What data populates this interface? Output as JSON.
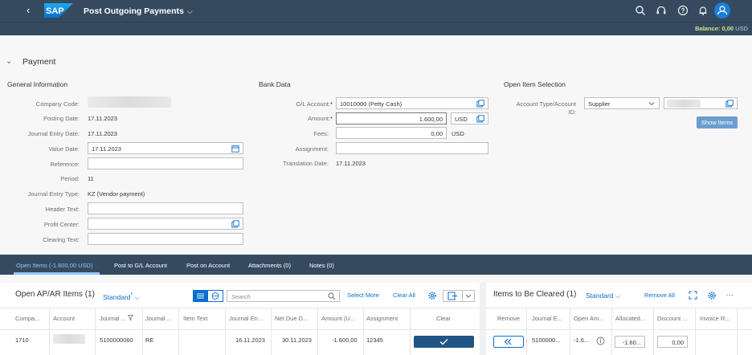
{
  "shell": {
    "app_title": "Post Outgoing Payments",
    "logo_text": "SAP",
    "icons": [
      "search-icon",
      "headset-icon",
      "help-icon",
      "bell-icon",
      "user-icon"
    ]
  },
  "balance": {
    "label": "Balance: 0,00",
    "unit": "USD"
  },
  "section": {
    "title": "Payment"
  },
  "general": {
    "title": "General Information",
    "company_code_label": "Company Code:",
    "posting_date_label": "Posting Date:",
    "posting_date": "17.11.2023",
    "journal_entry_date_label": "Journal Entry Date:",
    "journal_entry_date": "17.11.2023",
    "value_date_label": "Value Date:",
    "value_date": "17.11.2023",
    "reference_label": "Reference:",
    "period_label": "Period:",
    "period": "11",
    "journal_entry_type_label": "Journal Entry Type:",
    "journal_entry_type": "KZ (Vendor payment)",
    "header_text_label": "Header Text:",
    "profit_center_label": "Profit Center:",
    "clearing_text_label": "Clearing Text:"
  },
  "bank": {
    "title": "Bank Data",
    "gl_account_label": "G/L Account:",
    "gl_account": "10010000 (Petty Cash)",
    "amount_label": "Amount:",
    "amount": "1.600,00",
    "currency": "USD",
    "fees_label": "Fees:",
    "fees": "0,00",
    "fees_currency": "USD",
    "assignment_label": "Assignment:",
    "translation_date_label": "Translation Date:",
    "translation_date": "17.11.2023",
    "required_mark": "*"
  },
  "open_item_selection": {
    "title": "Open Item Selection",
    "account_type_label_1": "Account Type/Account",
    "account_type_label_2": "ID:",
    "account_type": "Supplier",
    "show_items": "Show Items"
  },
  "tabs": [
    {
      "label": "Open Items (-1.600,00 USD)",
      "active": true
    },
    {
      "label": "Post to G/L Account"
    },
    {
      "label": "Post on Account"
    },
    {
      "label": "Attachments (0)"
    },
    {
      "label": "Notes (0)"
    }
  ],
  "open_items": {
    "title": "Open AP/AR Items (1)",
    "variant": "Standard",
    "variant_mark": "*",
    "search_placeholder": "Search",
    "select_more": "Select More",
    "clear_all": "Clear All",
    "columns": [
      "Compa...",
      "Account",
      "Journal ...",
      "Journal ...",
      "Item Text",
      "Journal En...",
      "Net Due D...",
      "Amount (U...",
      "Assignment",
      "Clear"
    ],
    "row": {
      "company": "1710",
      "journal_entry": "5100000060",
      "journal_type": "RE",
      "item_text": "",
      "journal_entry_date": "16.11.2023",
      "net_due_date": "30.11.2023",
      "amount": "-1.600,00",
      "assignment": "12345"
    }
  },
  "cleared": {
    "title": "Items to Be Cleared (1)",
    "variant": "Standard",
    "remove_all": "Remove All",
    "columns": [
      "Remove",
      "Journal E...",
      "Open Am...",
      "Allocated...",
      "Discount ...",
      "Invoice R..."
    ],
    "row": {
      "journal_entry": "5100000...",
      "open_amount": "-1.6...",
      "allocated": "-1.60...",
      "discount": "0,00"
    }
  },
  "colors": {
    "shell": "#354a5f",
    "accent": "#0a6ed1",
    "balance": "#cfe78a",
    "clear_button": "#1e5585"
  }
}
